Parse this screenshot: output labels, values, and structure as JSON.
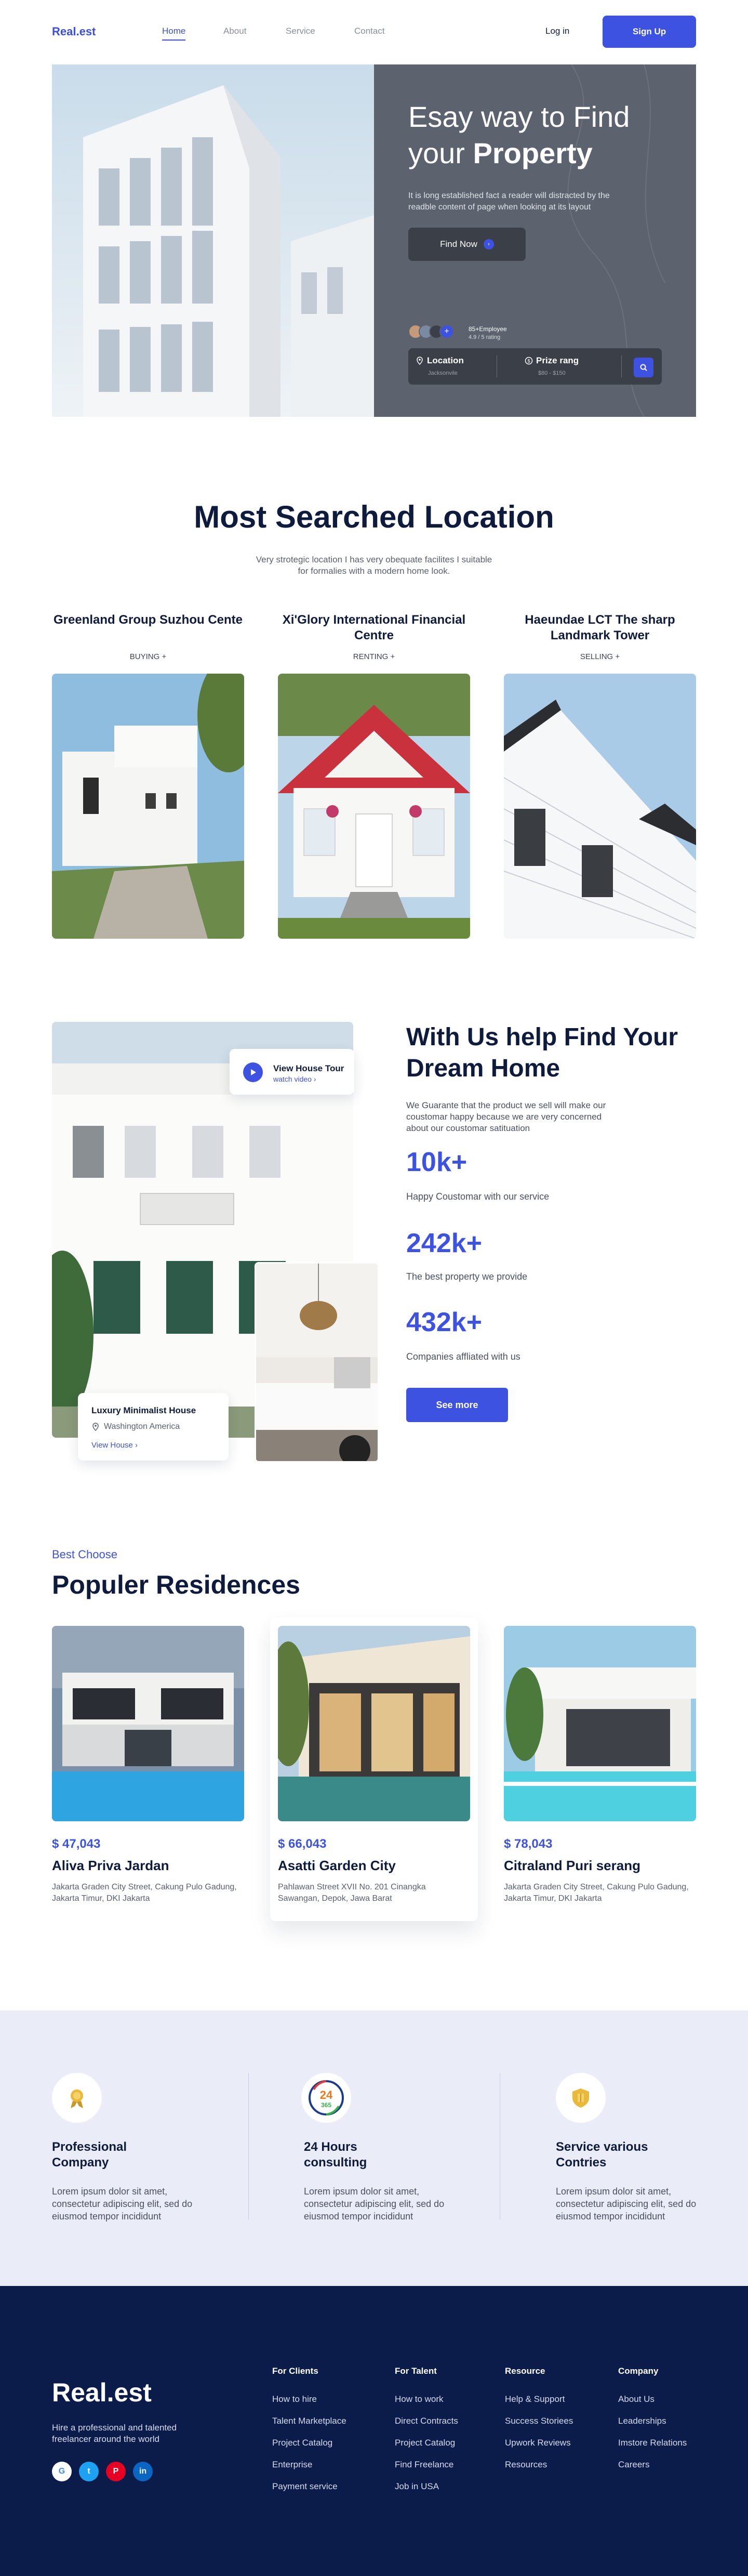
{
  "header": {
    "logo": "Real.est",
    "nav": [
      "Home",
      "About",
      "Service",
      "Contact"
    ],
    "login": "Log in",
    "signup": "Sign Up"
  },
  "hero": {
    "title_line1": "Esay way to Find",
    "title_line2_pre": "your ",
    "title_line2_bold": "Property",
    "desc": "It is long established fact a reader will distracted by the readble content of page when looking at its layout",
    "find_now": "Find Now",
    "employees": "85+Employee",
    "rating": "4.9 / 5 rating",
    "search": {
      "location_label": "Location",
      "location_sub": "Jacksonvile",
      "price_label": "Prize rang",
      "price_sub": "$80 - $150"
    }
  },
  "locations": {
    "title": "Most Searched Location",
    "subtitle": "Very strotegic location I has very obequate facilites I suitable for formalies with a modern home look.",
    "items": [
      {
        "name": "Greenland Group Suzhou Cente",
        "tag": "BUYING"
      },
      {
        "name": "Xi'Glory International Financial Centre",
        "tag": "RENTING"
      },
      {
        "name": "Haeundae LCT The sharp Landmark Tower",
        "tag": "SELLING"
      }
    ]
  },
  "help": {
    "title": "With Us help Find Your Dream Home",
    "desc": "We Guarante that the product we sell will make our coustomar happy because we are very concerned about our coustomar satituation",
    "stats": [
      {
        "num": "10k+",
        "label": "Happy Coustomar with our service"
      },
      {
        "num": "242k+",
        "label": "The best property we provide"
      },
      {
        "num": "432k+",
        "label": "Companies affliated with us"
      }
    ],
    "see_more": "See more",
    "tour_title": "View House Tour",
    "tour_sub": "watch video",
    "house_title": "Luxury Minimalist House",
    "house_loc": "Washington America",
    "house_link": "View House"
  },
  "residences": {
    "kicker": "Best Choose",
    "title": "Populer Residences",
    "items": [
      {
        "price": "$ 47,043",
        "name": "Aliva Priva Jardan",
        "addr": "Jakarta Graden City Street, Cakung Pulo Gadung, Jakarta Timur, DKI Jakarta"
      },
      {
        "price": "$ 66,043",
        "name": "Asatti Garden City",
        "addr": "Pahlawan Street XVII No. 201 Cinangka Sawangan, Depok, Jawa Barat"
      },
      {
        "price": "$ 78,043",
        "name": "Citraland Puri serang",
        "addr": "Jakarta Graden City Street, Cakung Pulo Gadung, Jakarta Timur, DKI Jakarta"
      }
    ]
  },
  "features": [
    {
      "title_1": "Professional",
      "title_2": "Company",
      "desc": "Lorem ipsum dolor sit amet, consectetur adipiscing elit, sed do eiusmod tempor incididunt"
    },
    {
      "title_1": "24 Hours",
      "title_2": "consulting",
      "desc": "Lorem ipsum dolor sit amet, consectetur adipiscing elit, sed do eiusmod tempor incididunt",
      "badge_top": "24",
      "badge_bot": "365"
    },
    {
      "title_1": "Service various",
      "title_2": "Contries",
      "desc": "Lorem ipsum dolor sit amet, consectetur adipiscing elit, sed do eiusmod tempor incididunt"
    }
  ],
  "footer": {
    "logo": "Real.est",
    "desc": "Hire a professional and talented freelancer around the world",
    "cols": [
      {
        "head": "For Clients",
        "links": [
          "How to hire",
          "Talent Marketplace",
          "Project Catalog",
          "Enterprise",
          "Payment service"
        ]
      },
      {
        "head": "For Talent",
        "links": [
          "How to work",
          "Direct Contracts",
          "Project Catalog",
          "Find Freelance",
          "Job in USA"
        ]
      },
      {
        "head": "Resource",
        "links": [
          "Help & Support",
          "Success Storiees",
          "Upwork Reviews",
          "Resources"
        ]
      },
      {
        "head": "Company",
        "links": [
          "About Us",
          "Leaderships",
          "Imstore Relations",
          "Careers"
        ]
      }
    ]
  },
  "colors": {
    "accent": "#3d52e0",
    "navy": "#0c1c4a",
    "feature_band": "#eaecf7"
  }
}
